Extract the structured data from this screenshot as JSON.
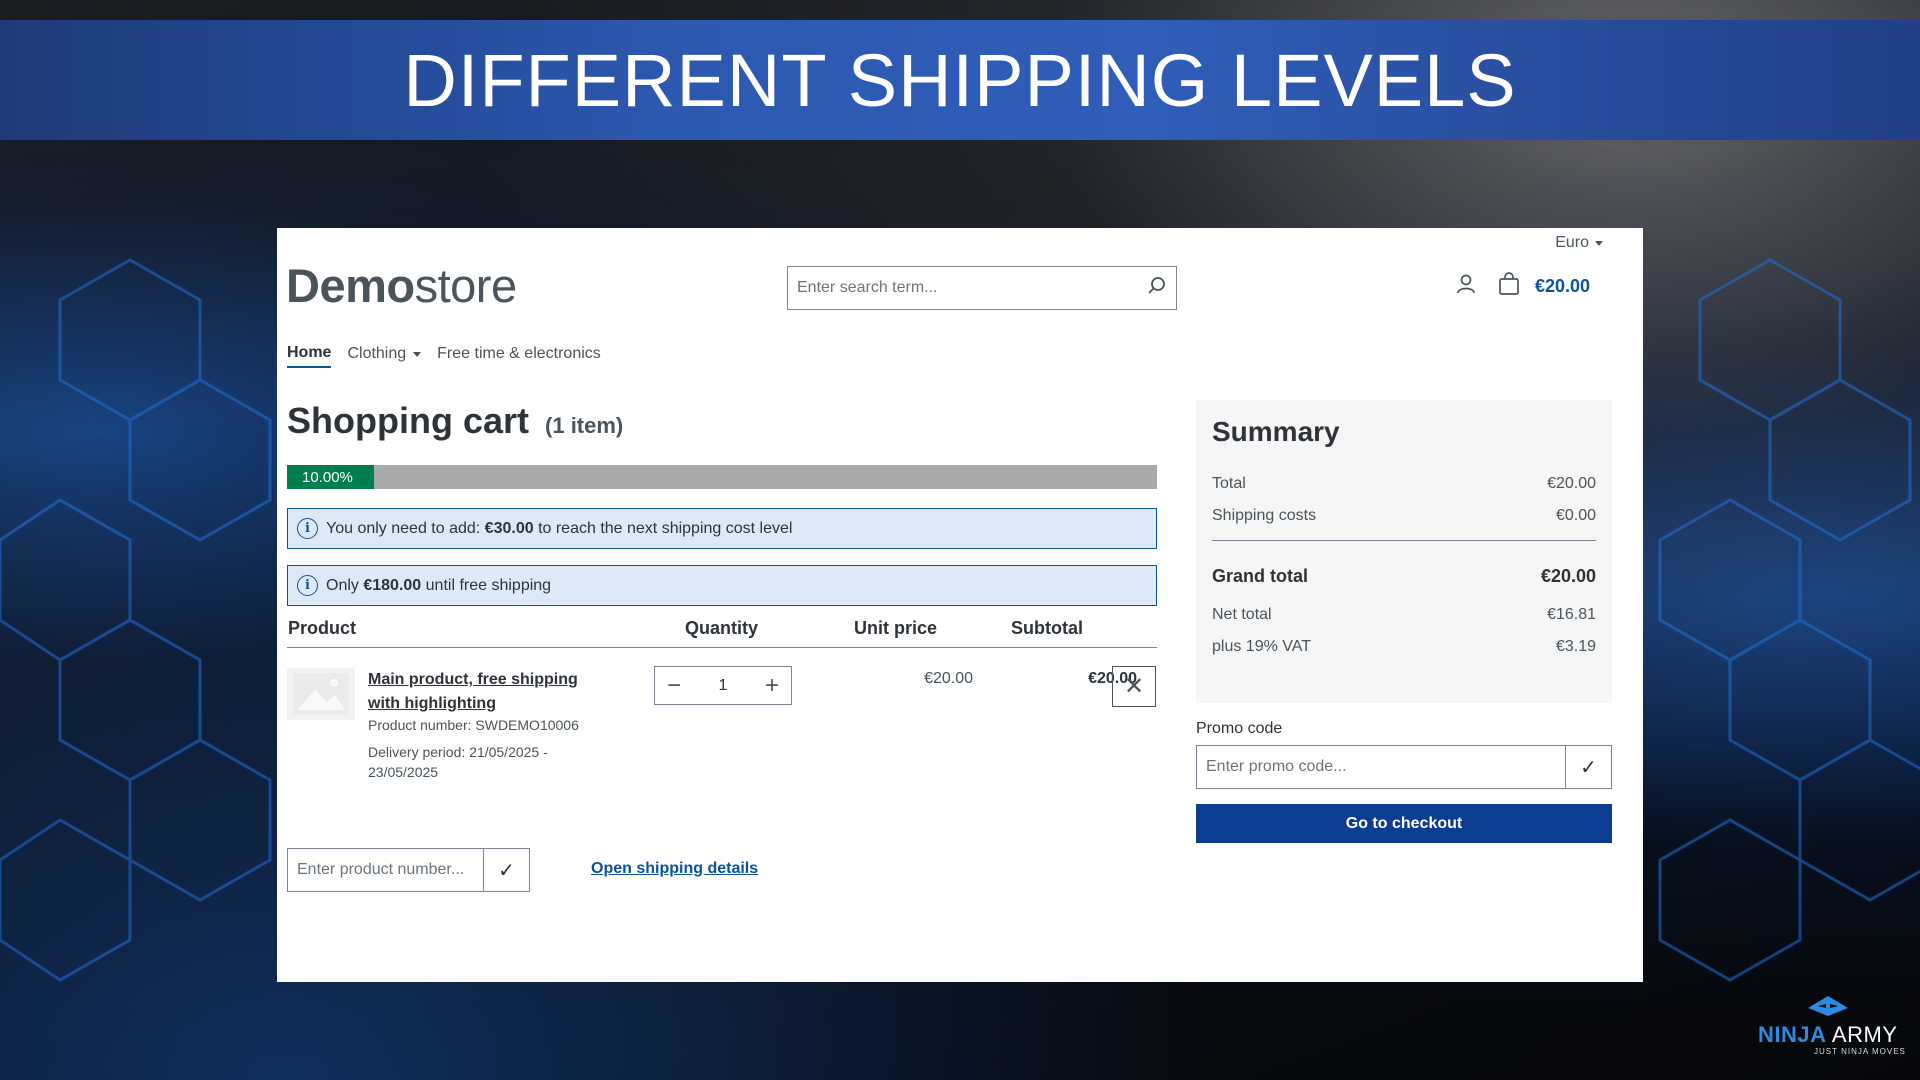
{
  "slide": {
    "title": "DIFFERENT SHIPPING LEVELS",
    "brand_name_primary": "NINJA",
    "brand_name_secondary": "ARMY",
    "brand_tagline": "JUST NINJA MOVES"
  },
  "header": {
    "currency": "Euro",
    "logo_bold": "Demo",
    "logo_light": "store",
    "search_placeholder": "Enter search term...",
    "cart_total": "€20.00"
  },
  "nav": {
    "items": [
      {
        "label": "Home",
        "active": true
      },
      {
        "label": "Clothing",
        "dropdown": true
      },
      {
        "label": "Free time & electronics"
      }
    ]
  },
  "cart": {
    "title": "Shopping cart",
    "item_count": "(1 item)",
    "progress_label": "10.00%",
    "progress_percent": 10,
    "alert1_prefix": "You only need to add:",
    "alert1_amount": "€30.00",
    "alert1_suffix": "to reach the next shipping cost level",
    "alert2_prefix": "Only",
    "alert2_amount": "€180.00",
    "alert2_suffix": "until free shipping",
    "columns": {
      "product": "Product",
      "quantity": "Quantity",
      "unit_price": "Unit price",
      "subtotal": "Subtotal"
    },
    "line_item": {
      "name": "Main product, free shipping with highlighting",
      "product_number": "Product number: SWDEMO10006",
      "delivery_period": "Delivery period: 21/05/2025 - 23/05/2025",
      "quantity": "1",
      "unit_price": "€20.00",
      "subtotal": "€20.00"
    },
    "add_product_placeholder": "Enter product number...",
    "shipping_details_link": "Open shipping details"
  },
  "summary": {
    "title": "Summary",
    "rows": {
      "total_label": "Total",
      "total_value": "€20.00",
      "shipping_label": "Shipping costs",
      "shipping_value": "€0.00",
      "grand_label": "Grand total",
      "grand_value": "€20.00",
      "net_label": "Net total",
      "net_value": "€16.81",
      "vat_label": "plus 19% VAT",
      "vat_value": "€3.19"
    },
    "promo_label": "Promo code",
    "promo_placeholder": "Enter promo code...",
    "checkout_label": "Go to checkout"
  },
  "colors": {
    "accent_blue": "#0b539b",
    "checkout_blue": "#0b3d91",
    "progress_green": "#007e4e",
    "alert_bg": "#dde9f7",
    "banner_blue": "#2c58b0"
  }
}
